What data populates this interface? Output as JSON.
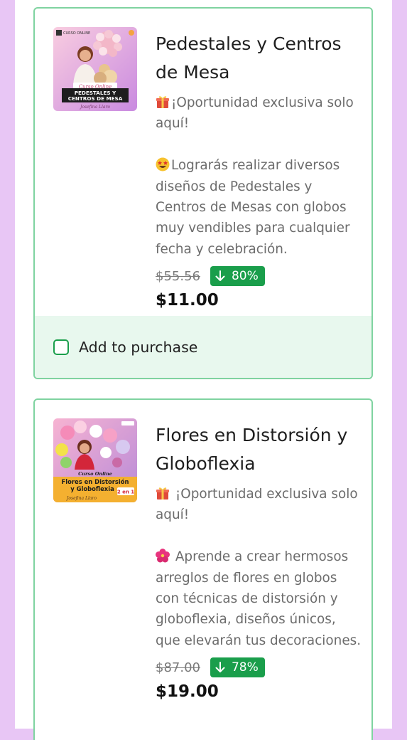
{
  "products": [
    {
      "title": "Pedestales y Centros de Mesa",
      "offer_line": "¡Oportunidad exclusiva solo aquí!",
      "offer_icon": "gift-icon",
      "description": "Lograrás realizar diversos diseños de Pedestales y Centros de Mesas con globos muy vendibles para cualquier fecha y celebración.",
      "description_icon": "star-eyes-emoji-icon",
      "old_price": "$55.56",
      "discount": "80%",
      "price": "$11.00",
      "thumbnail": {
        "tag": "Curso Online",
        "line1": "PEDESTALES Y",
        "line2": "CENTROS DE MESA",
        "signature": "Josefina Llaro",
        "colors": [
          "#f7c4d9",
          "#c57ad4"
        ]
      },
      "purchase_label": "Add to purchase",
      "purchase_checked": false
    },
    {
      "title": "Flores en Distorsión y Globoflexia",
      "offer_line": " ¡Oportunidad exclusiva solo aquí!",
      "offer_icon": "gift-icon",
      "description": " Aprende a crear hermosos arreglos de flores en globos con técnicas de distorsión y globoflexia, diseños únicos, que elevarán tus decoraciones.",
      "description_icon": "hibiscus-icon",
      "old_price": "$87.00",
      "discount": "78%",
      "price": "$19.00",
      "thumbnail": {
        "tag": "Curso Online",
        "line1": "Flores en Distorsión",
        "line2": "y Globoflexia",
        "badge": "2 en 1",
        "signature": "Josefina Llaro",
        "colors": [
          "#f5a6c8",
          "#f4b030"
        ]
      }
    }
  ],
  "colors": {
    "border": "#7fd3a0",
    "badge": "#1a9e4b",
    "purchase_bg": "#e8f8ee",
    "page_bg": "#e8c6f5"
  }
}
